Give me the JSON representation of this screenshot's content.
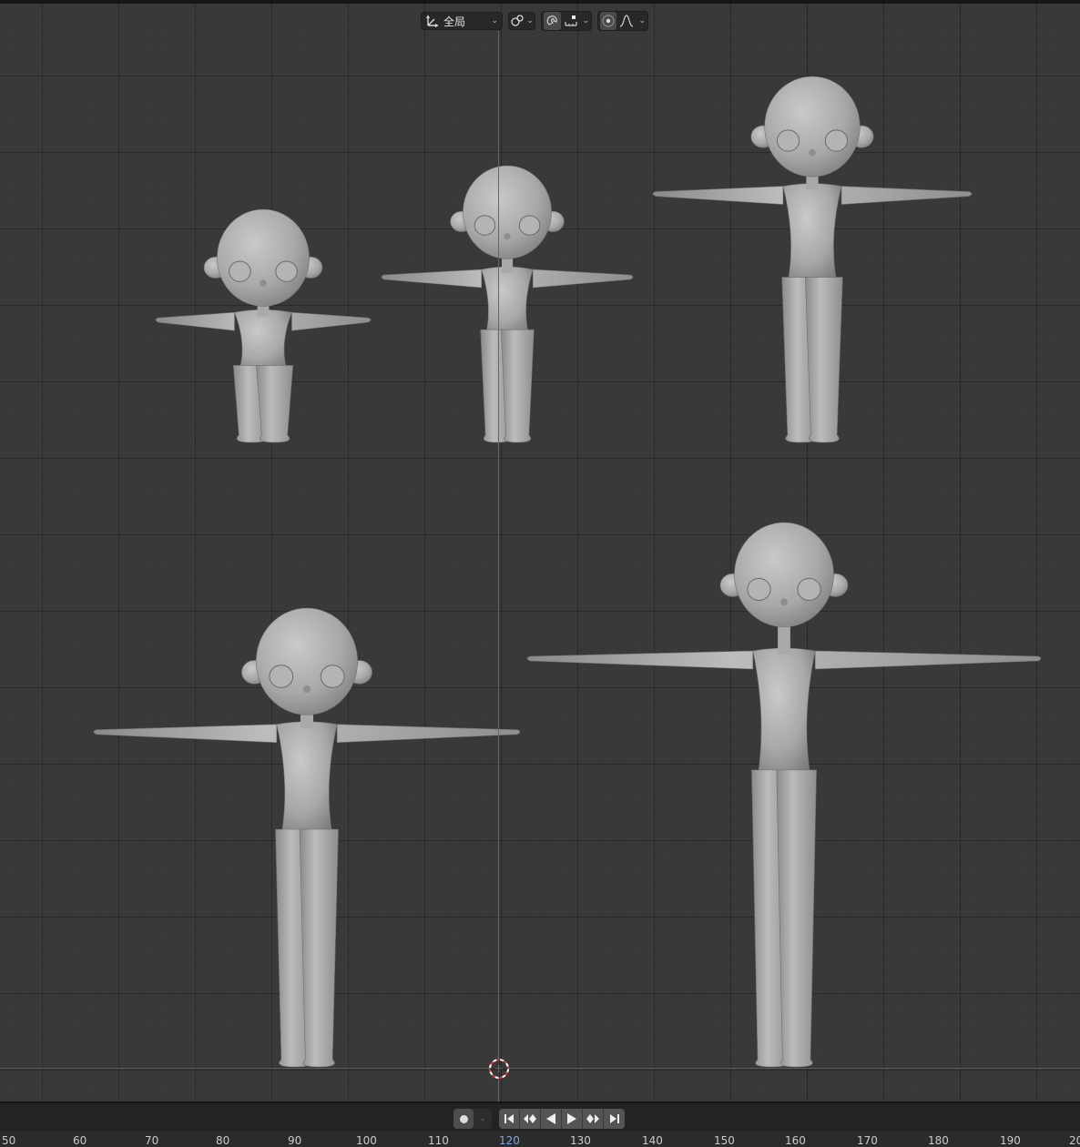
{
  "header": {
    "transform_orientation": {
      "label": "全局",
      "icon": "transform-orientation-icon"
    },
    "pivot_icon": "pivot-point-icon",
    "snap": {
      "icon": "magnet-snap-icon",
      "enabled": true
    },
    "snap_target_icon": "snap-increment-icon",
    "proportional_edit": {
      "icon": "proportional-edit-icon",
      "enabled": true
    },
    "falloff_icon": "falloff-curve-icon"
  },
  "viewport": {
    "models": [
      "character-chibi",
      "character-small",
      "character-tall-slim",
      "character-teen",
      "character-adult"
    ],
    "axis_colors": {
      "z": "#3f6ea9",
      "x": "#a33b3b"
    }
  },
  "timeline": {
    "ruler_ticks": [
      "50",
      "60",
      "70",
      "80",
      "90",
      "100",
      "110",
      "120",
      "130",
      "140",
      "150",
      "160",
      "170",
      "180",
      "190",
      "20"
    ],
    "current_frame": "120"
  }
}
